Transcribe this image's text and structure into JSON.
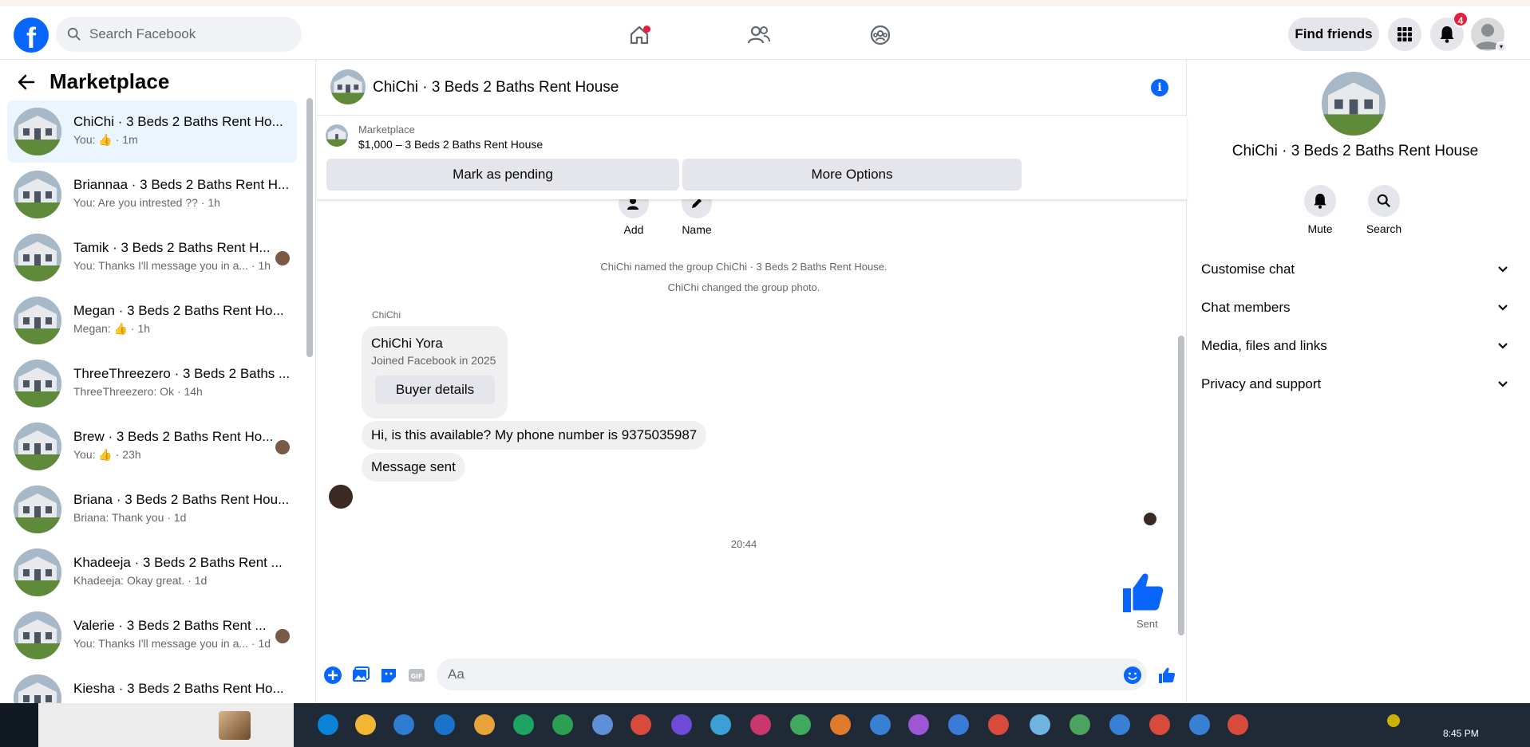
{
  "header": {
    "search_placeholder": "Search Facebook",
    "find_friends": "Find friends",
    "notifications_count": "4"
  },
  "sidebar": {
    "title": "Marketplace",
    "items": [
      {
        "name": "ChiChi · 3 Beds 2 Baths Rent Ho...",
        "sub": "You: 👍 · 1m",
        "active": true
      },
      {
        "name": "Briannaa · 3 Beds 2 Baths Rent H...",
        "sub": "You: Are you intrested ?? · 1h"
      },
      {
        "name": "Tamik · 3 Beds 2 Baths Rent H...",
        "sub": "You: Thanks I'll message you in a... · 1h"
      },
      {
        "name": "Megan · 3 Beds 2 Baths Rent Ho...",
        "sub": "Megan: 👍 · 1h"
      },
      {
        "name": "ThreeThreezero · 3 Beds 2 Baths ...",
        "sub": "ThreeThreezero: Ok · 14h"
      },
      {
        "name": "Brew · 3 Beds 2 Baths Rent Ho...",
        "sub": "You: 👍 · 23h"
      },
      {
        "name": "Briana · 3 Beds 2 Baths Rent Hou...",
        "sub": "Briana: Thank you · 1d"
      },
      {
        "name": "Khadeeja · 3 Beds 2 Baths Rent ...",
        "sub": "Khadeeja: Okay great. · 1d"
      },
      {
        "name": "Valerie · 3 Beds 2 Baths Rent ...",
        "sub": "You: Thanks I'll message you in a... · 1d"
      },
      {
        "name": "Kiesha · 3 Beds 2 Baths Rent Ho...",
        "sub": ""
      }
    ]
  },
  "chat": {
    "title": "ChiChi · 3 Beds 2 Baths Rent House",
    "marketplace_label": "Marketplace",
    "listing": "$1,000 – 3 Beds 2 Baths Rent House",
    "mark_pending": "Mark as pending",
    "more_options": "More Options",
    "add_label": "Add",
    "name_label": "Name",
    "system_1": "ChiChi named the group ChiChi · 3 Beds 2 Baths Rent House.",
    "system_2": "ChiChi changed the group photo.",
    "sender": "ChiChi",
    "card_name": "ChiChi Yora",
    "card_joined": "Joined Facebook in 2025",
    "buyer_details": "Buyer details",
    "message_1": "Hi, is this available? My phone number is 9375035987",
    "message_2": "Message sent",
    "timestamp": "20:44",
    "sent_label": "Sent",
    "composer_placeholder": "Aa"
  },
  "details": {
    "name": "ChiChi · 3 Beds 2 Baths Rent House",
    "mute": "Mute",
    "search": "Search",
    "sections": [
      "Customise chat",
      "Chat members",
      "Media, files and links",
      "Privacy and support"
    ]
  },
  "taskbar": {
    "time": "8:45 PM"
  },
  "colors": {
    "brand": "#0866ff",
    "active_item": "#ebf5ff",
    "bubble": "#f0f0f0",
    "badge": "#e41e3f"
  }
}
